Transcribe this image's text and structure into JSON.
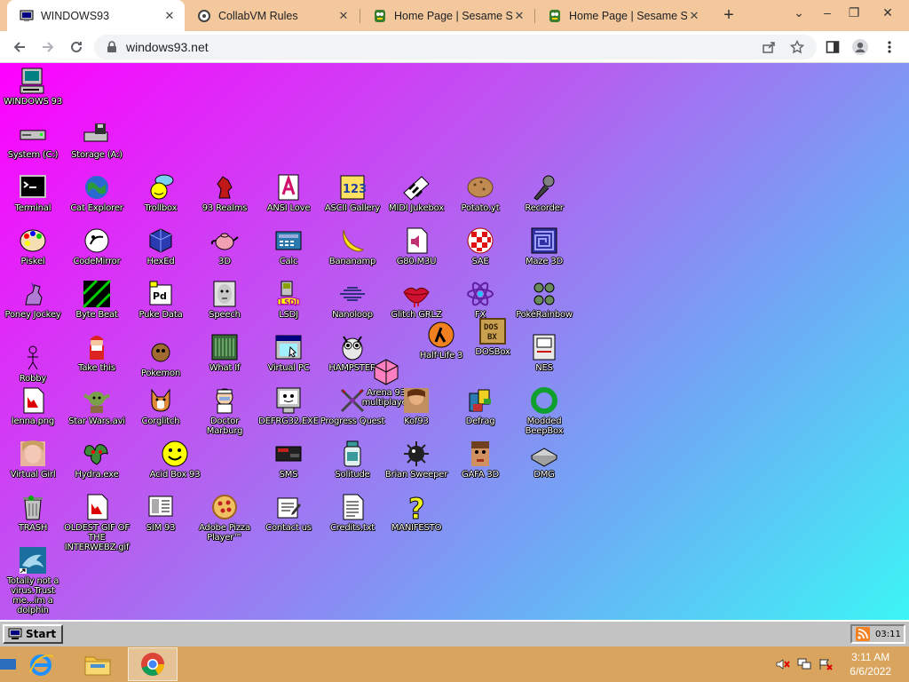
{
  "browser": {
    "tabs": [
      {
        "title": "WINDOWS93",
        "active": true,
        "icon": "windows93-favicon"
      },
      {
        "title": "CollabVM Rules",
        "active": false,
        "icon": "collabvm-favicon"
      },
      {
        "title": "Home Page | Sesame Stre",
        "active": false,
        "icon": "sesame-favicon"
      },
      {
        "title": "Home Page | Sesame Stre",
        "active": false,
        "icon": "sesame-favicon"
      }
    ],
    "new_tab": "+",
    "url": "windows93.net"
  },
  "desktop": {
    "icons": [
      {
        "label": "WINDOWS 93",
        "icon": "computer-icon"
      },
      {
        "label": "System (C:)",
        "icon": "drive-icon"
      },
      {
        "label": "Storage (A:)",
        "icon": "floppy-drive-icon"
      },
      {
        "label": "Terminal",
        "icon": "terminal-icon"
      },
      {
        "label": "Cat Explorer",
        "icon": "globe-icon"
      },
      {
        "label": "Trollbox",
        "icon": "chat-icon"
      },
      {
        "label": "93 Realms",
        "icon": "realms-icon"
      },
      {
        "label": "ANSI Love",
        "icon": "ansi-icon"
      },
      {
        "label": "ASCII Gallery",
        "icon": "ascii-icon"
      },
      {
        "label": "MIDI Jukebox",
        "icon": "piano-icon"
      },
      {
        "label": "Potato.yt",
        "icon": "potato-icon"
      },
      {
        "label": "Recorder",
        "icon": "microphone-icon"
      },
      {
        "label": "Piskel",
        "icon": "palette-icon"
      },
      {
        "label": "CodeMirror",
        "icon": "codemirror-icon"
      },
      {
        "label": "HexEd",
        "icon": "cube-icon"
      },
      {
        "label": "3D",
        "icon": "teapot-icon"
      },
      {
        "label": "Calc",
        "icon": "calculator-icon"
      },
      {
        "label": "Bananamp",
        "icon": "banana-icon"
      },
      {
        "label": "G80.M3U",
        "icon": "audio-file-icon"
      },
      {
        "label": "SAE",
        "icon": "amiga-ball-icon"
      },
      {
        "label": "Maze 3D",
        "icon": "maze-icon"
      },
      {
        "label": "Poney Jockey",
        "icon": "pony-icon"
      },
      {
        "label": "Byte Beat",
        "icon": "bytebeat-icon"
      },
      {
        "label": "Puke Data",
        "icon": "pukedata-icon"
      },
      {
        "label": "Speech",
        "icon": "face-icon"
      },
      {
        "label": "LSDJ",
        "icon": "gameboy-icon"
      },
      {
        "label": "Nanoloop",
        "icon": "nanoloop-icon"
      },
      {
        "label": "Glitch GRLZ",
        "icon": "lips-icon"
      },
      {
        "label": "FX",
        "icon": "atom-icon"
      },
      {
        "label": "PokéRainbow",
        "icon": "pokerainbow-icon"
      },
      {
        "label": "Half-Life 3",
        "icon": "half-life-icon"
      },
      {
        "label": "DOSBox",
        "icon": "dosbox-icon"
      },
      {
        "label": "Robby",
        "icon": "stick-figure-icon"
      },
      {
        "label": "Take this",
        "icon": "santa-icon"
      },
      {
        "label": "Pokemon",
        "icon": "pokemon-icon"
      },
      {
        "label": "What If",
        "icon": "whatif-icon"
      },
      {
        "label": "Virtual PC",
        "icon": "window-icon"
      },
      {
        "label": "HAMPSTER",
        "icon": "owl-icon"
      },
      {
        "label": "Arena 93 multiplayer",
        "icon": "arena-icon"
      },
      {
        "label": "NES",
        "icon": "nes-icon"
      },
      {
        "label": "lenna.png",
        "icon": "image-file-icon"
      },
      {
        "label": "Star Wars.avi",
        "icon": "yoda-icon"
      },
      {
        "label": "Corglitch",
        "icon": "corgi-icon"
      },
      {
        "label": "Doctor Marburg",
        "icon": "doctor-icon"
      },
      {
        "label": "DEFRG32.EXE",
        "icon": "defrag-monitor-icon"
      },
      {
        "label": "Progress Quest",
        "icon": "swords-icon"
      },
      {
        "label": "Kof93",
        "icon": "fighter-icon"
      },
      {
        "label": "Defrag",
        "icon": "defrag-icon"
      },
      {
        "label": "Modded BeepBox",
        "icon": "ring-icon"
      },
      {
        "label": "Virtual Girl",
        "icon": "virtual-girl-icon"
      },
      {
        "label": "Hydra.exe",
        "icon": "hydra-icon"
      },
      {
        "label": "Acid Box 93",
        "icon": "smiley-icon"
      },
      {
        "label": "SMS",
        "icon": "sms-console-icon"
      },
      {
        "label": "Solitude",
        "icon": "solitude-icon"
      },
      {
        "label": "Brian Sweeper",
        "icon": "mine-icon"
      },
      {
        "label": "GAFA 3D",
        "icon": "gafa-icon"
      },
      {
        "label": "DMG",
        "icon": "dmg-icon"
      },
      {
        "label": "TRASH",
        "icon": "trash-icon"
      },
      {
        "label": "OLDEST GIF OF THE INTERWEBZ.gif",
        "icon": "gif-file-icon"
      },
      {
        "label": "SIM 93",
        "icon": "sim-icon"
      },
      {
        "label": "Adobe Pizza Player™",
        "icon": "pizza-icon"
      },
      {
        "label": "Contact us",
        "icon": "contact-icon"
      },
      {
        "label": "Credits.txt",
        "icon": "text-file-icon"
      },
      {
        "label": "MANIFESTO",
        "icon": "question-mark-icon"
      },
      {
        "label": "Totally not a virus.Trust me...im a dolphin",
        "icon": "dolphin-icon"
      }
    ]
  },
  "w93_taskbar": {
    "start_label": "Start",
    "tray_time": "03:11"
  },
  "windows_taskbar": {
    "apps": [
      {
        "name": "Internet Explorer",
        "icon": "ie-icon"
      },
      {
        "name": "File Explorer",
        "icon": "folder-icon"
      },
      {
        "name": "Google Chrome",
        "icon": "chrome-icon"
      }
    ],
    "time": "3:11 AM",
    "date": "6/6/2022"
  },
  "colors": {
    "desktop_gradient_start": "#ff00ff",
    "desktop_gradient_end": "#3cf5f5",
    "tabstrip": "#f3c89c",
    "os_taskbar": "#d9a45e",
    "w93_taskbar": "#c3c3c3"
  }
}
